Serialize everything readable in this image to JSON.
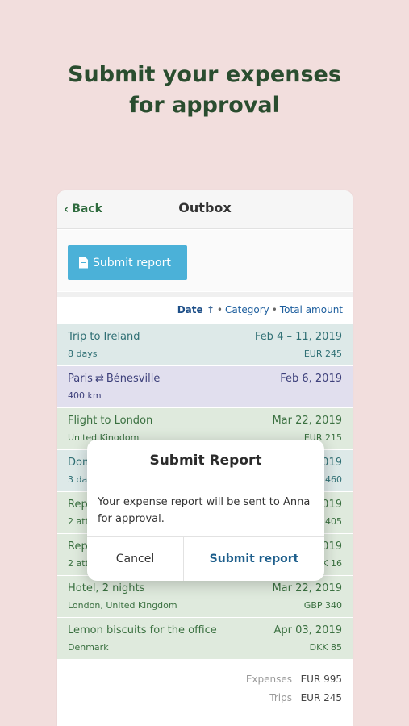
{
  "headline": {
    "line1": "Submit your expenses",
    "line2": "for approval"
  },
  "navbar": {
    "back_label": "Back",
    "title": "Outbox"
  },
  "toolbar": {
    "submit_label": "Submit report"
  },
  "sort": {
    "active": "Date",
    "arrow": "↑",
    "options": [
      "Category",
      "Total amount"
    ]
  },
  "rows": [
    {
      "title": "Trip to Ireland",
      "sub": "8 days",
      "date": "Feb 4 – 11, 2019",
      "amount": "EUR 245",
      "color": "#dde9e8"
    },
    {
      "title_from": "Paris",
      "title_to": "Bénesville",
      "sub": "400 km",
      "date": "Feb 6, 2019",
      "amount": "",
      "color": "#e1dfee"
    },
    {
      "title": "Flight to London",
      "sub": "United Kingdom",
      "date": "Mar 22, 2019",
      "amount": "EUR 215",
      "color": "#dfeadd"
    },
    {
      "title": "Dom",
      "sub": "3 da",
      "date": "019",
      "amount": "460",
      "color": "#dde9e8"
    },
    {
      "title": "Rep",
      "sub": "2 att",
      "date": "019",
      "amount": "405",
      "color": "#dfeadd"
    },
    {
      "title": "Rep",
      "sub": "2 att",
      "date": "019",
      "amount": "K 16",
      "color": "#dfeadd"
    },
    {
      "title": "Hotel, 2 nights",
      "sub": "London, United Kingdom",
      "date": "Mar 22, 2019",
      "amount": "GBP 340",
      "color": "#dfeadd"
    },
    {
      "title": "Lemon biscuits for the office",
      "sub": "Denmark",
      "date": "Apr 03, 2019",
      "amount": "DKK 85",
      "color": "#dfeadd"
    }
  ],
  "totals": {
    "expenses_label": "Expenses",
    "expenses_value": "EUR 995",
    "trips_label": "Trips",
    "trips_value": "EUR 245"
  },
  "dialog": {
    "title": "Submit Report",
    "message": "Your expense report will be sent to Anna for approval.",
    "cancel_label": "Cancel",
    "confirm_label": "Submit report"
  }
}
